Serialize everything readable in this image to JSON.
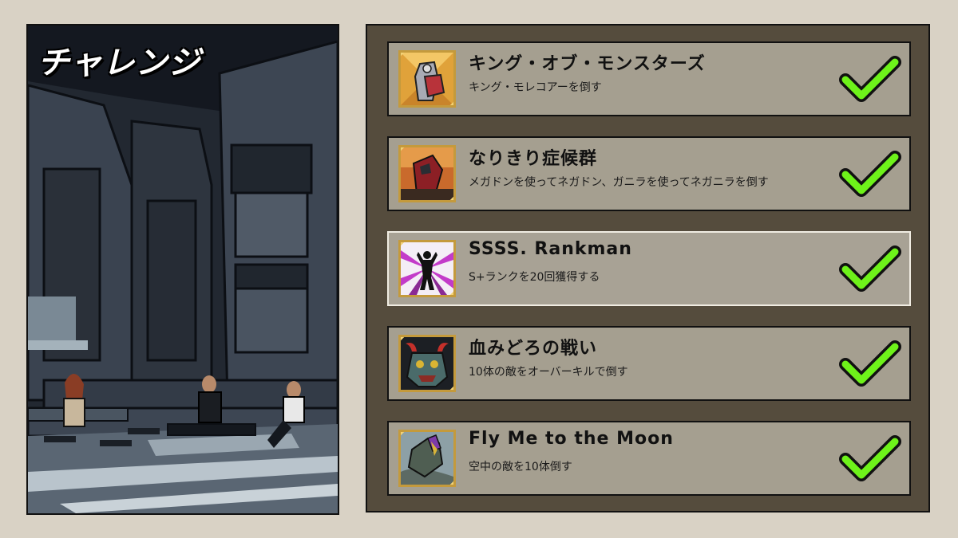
{
  "screen_title": "チャレンジ",
  "challenges": [
    {
      "title": "キング・オブ・モンスターズ",
      "description": "キング・モレコアーを倒す",
      "completed": true,
      "icon": "mecha-monster-icon",
      "selected": false
    },
    {
      "title": "なりきり症候群",
      "description": "メガドンを使ってネガドン、ガニラを使ってネガニラを倒す",
      "completed": true,
      "icon": "red-mecha-icon",
      "selected": false
    },
    {
      "title": "SSSS. Rankman",
      "description": "S+ランクを20回獲得する",
      "completed": true,
      "icon": "posing-hero-icon",
      "selected": true
    },
    {
      "title": "血みどろの戦い",
      "description": "10体の敵をオーバーキルで倒す",
      "completed": true,
      "icon": "horned-beast-icon",
      "selected": false
    },
    {
      "title": "Fly Me to the Moon",
      "description": "空中の敵を10体倒す",
      "completed": true,
      "icon": "flying-kaiju-icon",
      "selected": false
    }
  ],
  "colors": {
    "background": "#d9d2c5",
    "panel": "#554c3d",
    "card": "#a59f90",
    "check": "#6ef21a",
    "frame": "#c49a3c"
  }
}
